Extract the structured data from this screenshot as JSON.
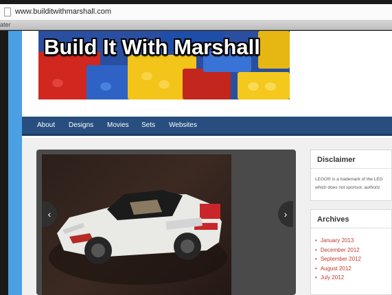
{
  "browser": {
    "url": "www.builditwithmarshall.com",
    "tab_label": "ater"
  },
  "site": {
    "title": "Build It With Marshall"
  },
  "nav": {
    "items": [
      "About",
      "Designs",
      "Movies",
      "Sets",
      "Websites"
    ]
  },
  "slider": {
    "prev_glyph": "‹",
    "next_glyph": "›",
    "photo_icon": "lego-car-icon"
  },
  "sidebar": {
    "disclaimer": {
      "title": "Disclaimer",
      "lines": [
        "LEGO® is a trademark of the LEG",
        "which does not sponsor, authoriz"
      ]
    },
    "archives": {
      "title": "Archives",
      "items": [
        "January 2013",
        "December 2012",
        "September 2012",
        "August 2012",
        "July 2012"
      ]
    }
  },
  "colors": {
    "accent_stripe": "#4aa0e2",
    "nav_bg": "#274e7e",
    "archive_link": "#c0392b"
  }
}
